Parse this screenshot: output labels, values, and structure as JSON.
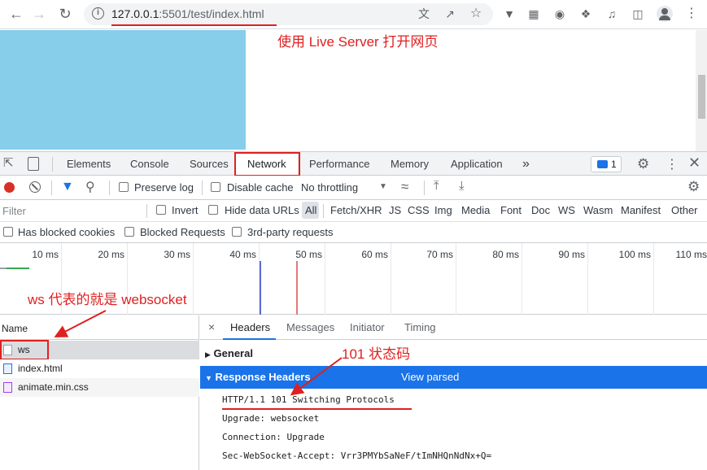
{
  "browser": {
    "url_host": "127.0.0.1",
    "url_rest": ":5501/test/index.html",
    "back_icon": "arrow-left",
    "forward_icon": "arrow-right",
    "reload_icon": "reload"
  },
  "annotations": {
    "live_server": "使用 Live Server 打开网页",
    "ws_meaning": "ws 代表的就是 websocket",
    "status_code": "101 状态码"
  },
  "devtools": {
    "tabs": [
      "Elements",
      "Console",
      "Sources",
      "Network",
      "Performance",
      "Memory",
      "Application"
    ],
    "active_tab": "Network",
    "more_tabs": "»",
    "issues_count": "1"
  },
  "network_toolbar": {
    "preserve_log": "Preserve log",
    "disable_cache": "Disable cache",
    "throttling": "No throttling"
  },
  "filter": {
    "placeholder": "Filter",
    "invert": "Invert",
    "hide_data_urls": "Hide data URLs",
    "types": [
      "All",
      "Fetch/XHR",
      "JS",
      "CSS",
      "Img",
      "Media",
      "Font",
      "Doc",
      "WS",
      "Wasm",
      "Manifest",
      "Other"
    ],
    "has_blocked_cookies": "Has blocked cookies",
    "blocked_requests": "Blocked Requests",
    "third_party": "3rd-party requests"
  },
  "timeline": {
    "ticks": [
      "10 ms",
      "20 ms",
      "30 ms",
      "40 ms",
      "50 ms",
      "60 ms",
      "70 ms",
      "80 ms",
      "90 ms",
      "100 ms",
      "110 ms"
    ]
  },
  "requests": {
    "header": "Name",
    "items": [
      "ws",
      "index.html",
      "animate.min.css"
    ]
  },
  "detail": {
    "close": "×",
    "tabs": [
      "Headers",
      "Messages",
      "Initiator",
      "Timing"
    ],
    "general": "General",
    "response_headers": "Response Headers",
    "view_parsed": "View parsed",
    "lines": [
      "HTTP/1.1 101 Switching Protocols",
      "Upgrade: websocket",
      "Connection: Upgrade",
      "Sec-WebSocket-Accept: Vrr3PMYbSaNeF/tImNHQnNdNx+Q="
    ]
  },
  "colors": {
    "accent": "#1a73e8",
    "annotation": "#e02020",
    "blue_box": "#87ceeb"
  }
}
